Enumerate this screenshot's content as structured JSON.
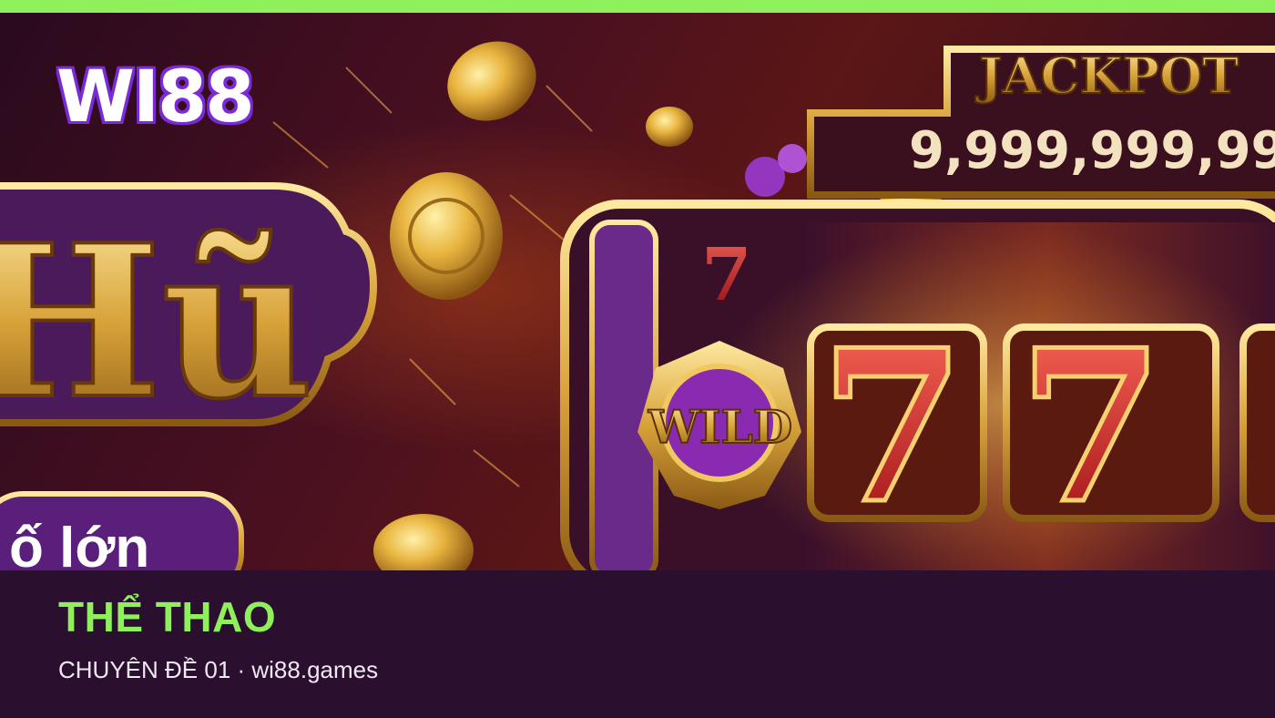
{
  "brand": {
    "logo_text": "WI88"
  },
  "banner": {
    "headline_partial": "Hũ",
    "subline_partial": "ố lớn",
    "jackpot_label": "JACKPOT",
    "jackpot_amount": "9,999,999,99",
    "wild_label": "WILD",
    "seven_symbol": "7"
  },
  "caption": {
    "title": "THỂ THAO",
    "subtitle": "CHUYÊN ĐỀ 01 · wi88.games"
  },
  "colors": {
    "accent_green": "#8ef05a",
    "background": "#2b0f2f",
    "gold": "#e8b84a",
    "purple": "#6a2a9a"
  }
}
